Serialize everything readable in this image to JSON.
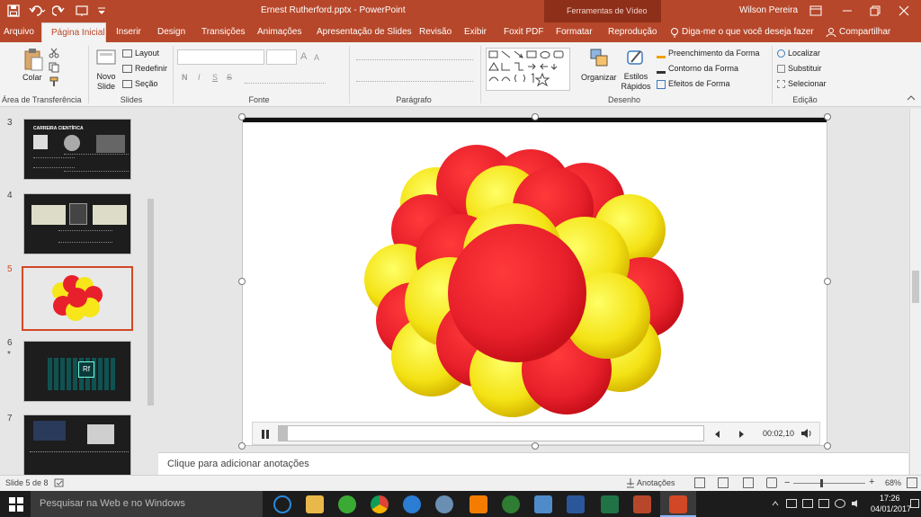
{
  "titlebar": {
    "title": "Ernest Rutherford.pptx  -  PowerPoint",
    "context_tools": "Ferramentas de Vídeo",
    "user": "Wilson Pereira"
  },
  "tabs": [
    {
      "label": "Arquivo"
    },
    {
      "label": "Página Inicial",
      "active": true
    },
    {
      "label": "Inserir"
    },
    {
      "label": "Design"
    },
    {
      "label": "Transições"
    },
    {
      "label": "Animações"
    },
    {
      "label": "Apresentação de Slides"
    },
    {
      "label": "Revisão"
    },
    {
      "label": "Exibir"
    },
    {
      "label": "Foxit PDF"
    },
    {
      "label": "Formatar"
    },
    {
      "label": "Reprodução"
    }
  ],
  "tell_me": "Diga-me o que você deseja fazer",
  "share": "Compartilhar",
  "ribbon": {
    "clipboard": {
      "paste": "Colar",
      "label": "Área de Transferência"
    },
    "slides": {
      "new_slide": "Novo Slide",
      "layout": "Layout",
      "reset": "Redefinir",
      "section": "Seção",
      "label": "Slides"
    },
    "font": {
      "label": "Fonte",
      "bold": "N",
      "italic": "I",
      "underline": "S",
      "strike": "S",
      "size_up": "A",
      "size_down": "A"
    },
    "paragraph": {
      "label": "Parágrafo"
    },
    "drawing": {
      "arrange": "Organizar",
      "quick_styles": "Estilos Rápidos",
      "shape_fill": "Preenchimento da Forma",
      "shape_outline": "Contorno da Forma",
      "shape_effects": "Efeitos de Forma",
      "label": "Desenho"
    },
    "editing": {
      "find": "Localizar",
      "replace": "Substituir",
      "select": "Selecionar",
      "label": "Edição"
    }
  },
  "slides": [
    {
      "num": "3",
      "title": "CARREIRA CIENTÍFICA"
    },
    {
      "num": "4"
    },
    {
      "num": "5",
      "selected": true
    },
    {
      "num": "6",
      "star": "*",
      "element": "Rf"
    },
    {
      "num": "7"
    }
  ],
  "video": {
    "time": "00:02,10",
    "progress": 0.02
  },
  "notes_placeholder": "Clique para adicionar anotações",
  "status": {
    "slide": "Slide 5 de 8",
    "notes": "Anotações",
    "zoom": "68%"
  },
  "taskbar": {
    "search": "Pesquisar na Web e no Windows",
    "time": "17:26",
    "date": "04/01/2017"
  },
  "colors": {
    "accent": "#b7472a",
    "red": "#e8202b",
    "yellow": "#f6e61a"
  }
}
